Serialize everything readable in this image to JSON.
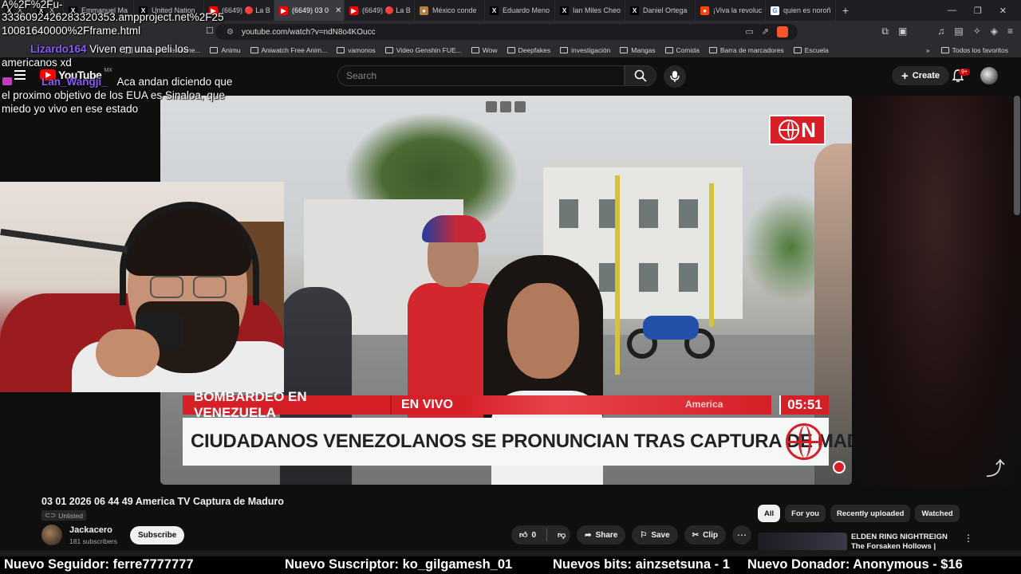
{
  "browser": {
    "tabs": [
      {
        "label": "X",
        "icon": "x-logo-icon"
      },
      {
        "label": "X",
        "icon": "x-logo-icon"
      },
      {
        "label": "Emmanuel Ma",
        "icon": "x-logo-icon"
      },
      {
        "label": "United Nation",
        "icon": "x-logo-icon"
      },
      {
        "label": "(6649) 🔴 La B",
        "icon": "youtube-icon"
      },
      {
        "label": "(6649) 03 0",
        "icon": "youtube-icon",
        "active": true
      },
      {
        "label": "(6649) 🔴 La B",
        "icon": "youtube-icon"
      },
      {
        "label": "México conde",
        "icon": "news-icon"
      },
      {
        "label": "Eduardo Meno",
        "icon": "x-logo-icon"
      },
      {
        "label": "Ian Miles Cheo",
        "icon": "x-logo-icon"
      },
      {
        "label": "Daniel Ortega",
        "icon": "x-logo-icon"
      },
      {
        "label": "¡Viva la revoluc",
        "icon": "reddit-icon"
      },
      {
        "label": "quien es noroñ",
        "icon": "google-icon"
      }
    ],
    "url": "youtube.com/watch?v=ndN8o4KOucc",
    "bookmarks": [
      "Watch anime online...",
      "Animu",
      "Aniwatch Free Anim...",
      "vamonos",
      "Video Genshin FUE...",
      "Wow",
      "Deepfakes",
      "investigación",
      "Mangas",
      "Comida",
      "Barra de marcadores",
      "Escuela"
    ],
    "bookmarks_all": "Todos los favoritos"
  },
  "youtube": {
    "logo_text": "YouTube",
    "country": "MX",
    "search_placeholder": "Search",
    "create_label": "Create",
    "notif_badge": "9+"
  },
  "video": {
    "banner_left": "BOMBARDEO EN VENEZUELA",
    "banner_live": "EN VIVO",
    "banner_time": "05:51",
    "banner_network": "America",
    "headline": "CIUDADANOS VENEZOLANOS SE PRONUNCIAN TRAS CAPTURA DE MADURO",
    "channel_bug": "N"
  },
  "overlay": {
    "url_fragment_1": "A%2F%2Fu-",
    "url_fragment_2": "3336092426283320353.ampproject.net%2F25",
    "url_fragment_3": "10081640000%2Fframe.html",
    "chat_1_name": "Lizardo164",
    "chat_1_text": "Viven en una peli los",
    "chat_1_text_2": "americanos xd",
    "chat_2_name": "Lan_Wangji_",
    "chat_2_text": "Aca andan diciendo que",
    "chat_2_text_2": "el proximo objetivo de los EUA es Sinaloa, que",
    "chat_2_text_3": "miedo yo vivo en ese estado"
  },
  "meta": {
    "title": "03 01 2026 06 44 49 America TV Captura de Maduro",
    "visibility": "Unlisted",
    "channel": "Jackacero",
    "subscribers": "181 subscribers",
    "subscribe": "Subscribe",
    "likes": "0",
    "share": "Share",
    "save": "Save",
    "clip": "Clip"
  },
  "chips": [
    "All",
    "For you",
    "Recently uploaded",
    "Watched"
  ],
  "recommended": {
    "title": "ELDEN RING NIGHTREIGN The Forsaken Hollows | Official"
  },
  "ticker": {
    "follower": "Nuevo Seguidor: ferre7777777",
    "subscriber": "Nuevo Suscriptor: ko_gilgamesh_01",
    "bits": "Nuevos bits: ainzsetsuna - 1",
    "donor": "Nuevo Donador: Anonymous - $16"
  }
}
